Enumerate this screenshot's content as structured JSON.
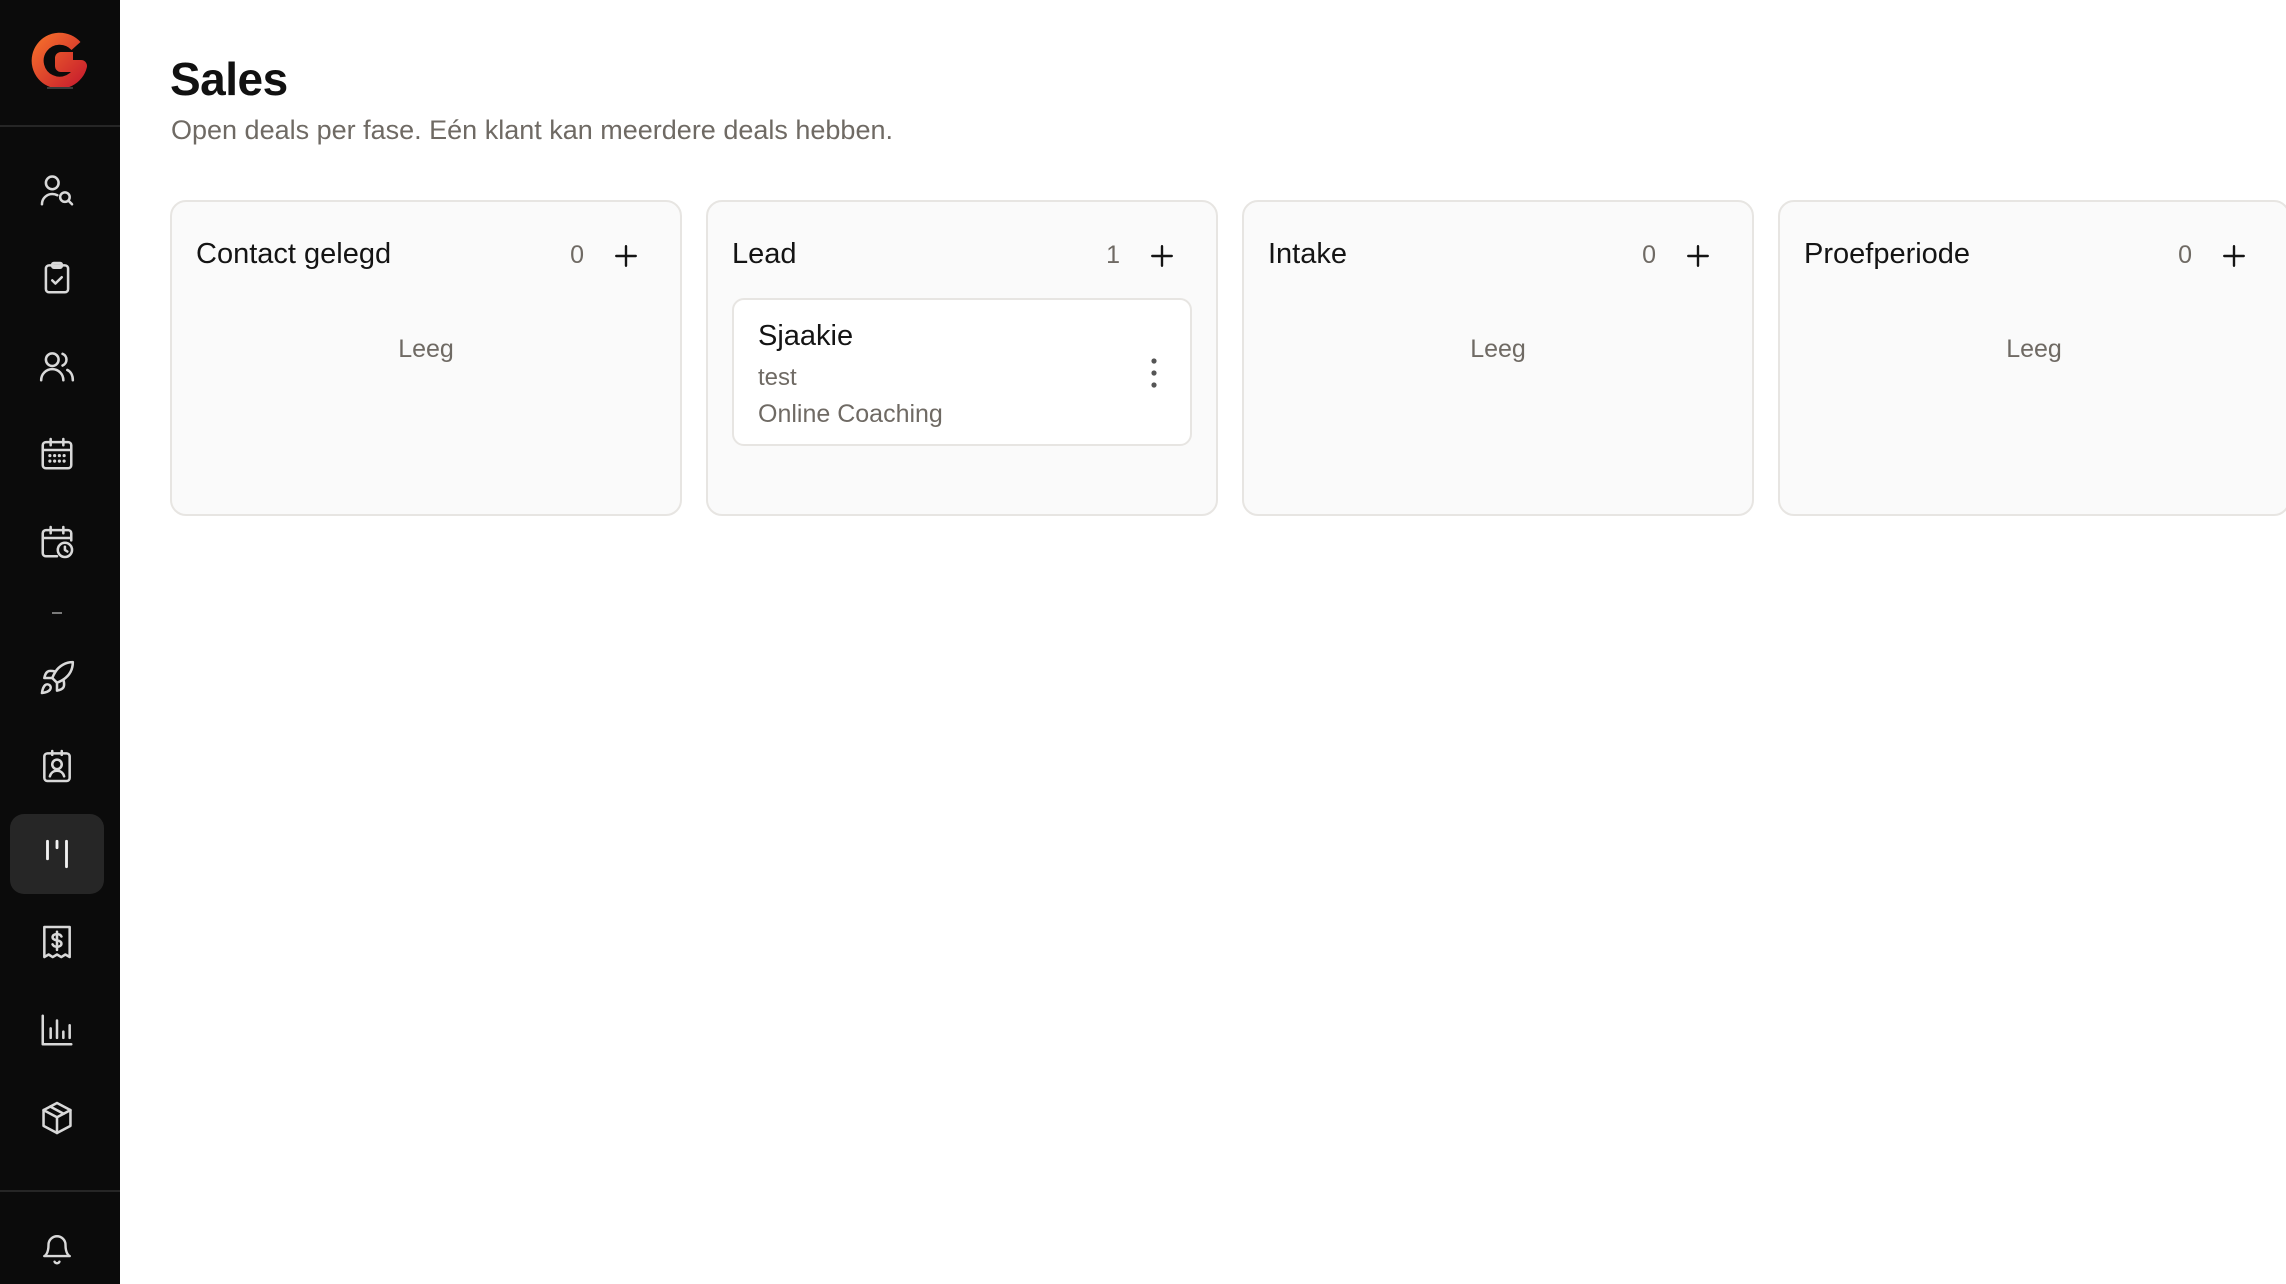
{
  "app": {
    "accent": "#e8542a",
    "sidebar_bg": "#0b0b0b"
  },
  "sidebar": {
    "logo_icon": "brand-g-logo",
    "items": [
      {
        "icon": "user-search-icon",
        "active": false
      },
      {
        "icon": "clipboard-check-icon",
        "active": false
      },
      {
        "icon": "users-icon",
        "active": false
      },
      {
        "icon": "calendar-grid-icon",
        "active": false
      },
      {
        "icon": "calendar-clock-icon",
        "active": false
      },
      {
        "icon": "rocket-icon",
        "active": false
      },
      {
        "icon": "contact-card-icon",
        "active": false
      },
      {
        "icon": "kanban-icon",
        "active": true
      },
      {
        "icon": "receipt-dollar-icon",
        "active": false
      },
      {
        "icon": "bar-chart-icon",
        "active": false
      },
      {
        "icon": "package-icon",
        "active": false
      }
    ],
    "bottom_icon": "bell-icon"
  },
  "page": {
    "title": "Sales",
    "subtitle": "Open deals per fase. Eén klant kan meerdere deals hebben."
  },
  "board": {
    "columns": [
      {
        "title": "Contact gelegd",
        "count": "0",
        "empty_text": "Leeg",
        "deals": []
      },
      {
        "title": "Lead",
        "count": "1",
        "empty_text": "",
        "deals": [
          {
            "name": "Sjaakie",
            "subtitle": "test",
            "product": "Online Coaching"
          }
        ]
      },
      {
        "title": "Intake",
        "count": "0",
        "empty_text": "Leeg",
        "deals": []
      },
      {
        "title": "Proefperiode",
        "count": "0",
        "empty_text": "Leeg",
        "deals": []
      }
    ]
  }
}
